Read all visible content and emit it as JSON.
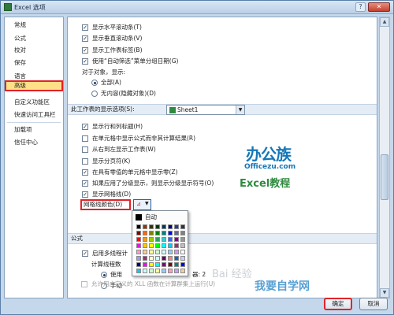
{
  "window": {
    "title": "Excel 选项",
    "help_glyph": "?",
    "close_glyph": "✕"
  },
  "sidebar": {
    "items": [
      {
        "label": "常规"
      },
      {
        "label": "公式"
      },
      {
        "label": "校对"
      },
      {
        "label": "保存"
      },
      {
        "label": "语言"
      },
      {
        "label": "高级",
        "selected": true
      },
      {
        "label": "自定义功能区"
      },
      {
        "label": "快速访问工具栏"
      },
      {
        "label": "加载项"
      },
      {
        "label": "信任中心"
      }
    ]
  },
  "workbook_options": {
    "show_hscroll": {
      "label": "显示水平滚动条(T)",
      "checked": true
    },
    "show_vscroll": {
      "label": "显示垂直滚动条(V)",
      "checked": true
    },
    "show_tabs": {
      "label": "显示工作表标签(B)",
      "checked": true
    },
    "autofilter_dates": {
      "label": "使用“自动筛选”菜单分组日期(G)",
      "checked": true
    },
    "objects_label": "对于对象，显示:",
    "objects_all": {
      "label": "全部(A)",
      "selected": true
    },
    "objects_none": {
      "label": "无内容(隐藏对象)(D)",
      "selected": false
    }
  },
  "sheet_section": {
    "title": "此工作表的显示选项(S):",
    "sheet_name": "Sheet1",
    "show_headers": {
      "label": "显示行和列标题(H)",
      "checked": true
    },
    "show_formulas": {
      "label": "在单元格中显示公式而非其计算结果(R)",
      "checked": false
    },
    "right_to_left": {
      "label": "从右到左显示工作表(W)",
      "checked": false
    },
    "show_page_breaks": {
      "label": "显示分页符(K)",
      "checked": false
    },
    "show_zeros": {
      "label": "在具有零值的单元格中显示零(Z)",
      "checked": true
    },
    "show_outline": {
      "label": "如果应用了分级显示，则显示分级显示符号(O)",
      "checked": true
    },
    "show_gridlines": {
      "label": "显示网格线(D)",
      "checked": true
    },
    "gridline_color_label": "网格线颜色(D)",
    "gridline_color_button_glyph": "⊿",
    "gridline_color_arrow": "▼"
  },
  "palette": {
    "auto_label": "自动",
    "colors": [
      [
        "#000000",
        "#993300",
        "#333300",
        "#003300",
        "#003366",
        "#000080",
        "#333399",
        "#333333"
      ],
      [
        "#800000",
        "#ff6600",
        "#808000",
        "#008000",
        "#008080",
        "#0000ff",
        "#666699",
        "#808080"
      ],
      [
        "#ff0000",
        "#ff9900",
        "#99cc00",
        "#339966",
        "#33cccc",
        "#3366ff",
        "#800080",
        "#969696"
      ],
      [
        "#ff00ff",
        "#ffcc00",
        "#ffff00",
        "#00ff00",
        "#00ffff",
        "#00ccff",
        "#993366",
        "#c0c0c0"
      ],
      [
        "#ff99cc",
        "#ffcc99",
        "#ffff99",
        "#ccffcc",
        "#ccffff",
        "#99ccff",
        "#cc99ff",
        "#ffffff"
      ],
      [
        "#9999ff",
        "#993366",
        "#ffffcc",
        "#ccffff",
        "#660066",
        "#ff8080",
        "#0066cc",
        "#ccccff"
      ],
      [
        "#000080",
        "#ff00ff",
        "#ffff00",
        "#00ffff",
        "#800080",
        "#800000",
        "#008080",
        "#0000ff"
      ],
      [
        "#00ccff",
        "#ccffff",
        "#ccffcc",
        "#ffff99",
        "#99ccff",
        "#ff99cc",
        "#cc99ff",
        "#ffcc99"
      ]
    ]
  },
  "formula_section": {
    "title": "公式",
    "multithread": {
      "label": "启用多线程计",
      "checked": true
    },
    "threads_label": "计算线程数",
    "use_all": {
      "label": "使用",
      "selected": true
    },
    "manual": {
      "label": "手动",
      "selected": false
    },
    "threads_suffix": "器: 2",
    "xll_cluster": {
      "label": "允许用户定义的 XLL 函数在计算群集上运行(U)",
      "checked": false
    }
  },
  "logo": {
    "cn": "办公族",
    "url": "Officezu.com",
    "excel": "Excel教程"
  },
  "watermark": {
    "text": "我要自学网",
    "baidu": "Bai 经验"
  },
  "buttons": {
    "ok": "确定",
    "cancel": "取消"
  },
  "scrollbar": {
    "up": "▲",
    "down": "▼"
  }
}
